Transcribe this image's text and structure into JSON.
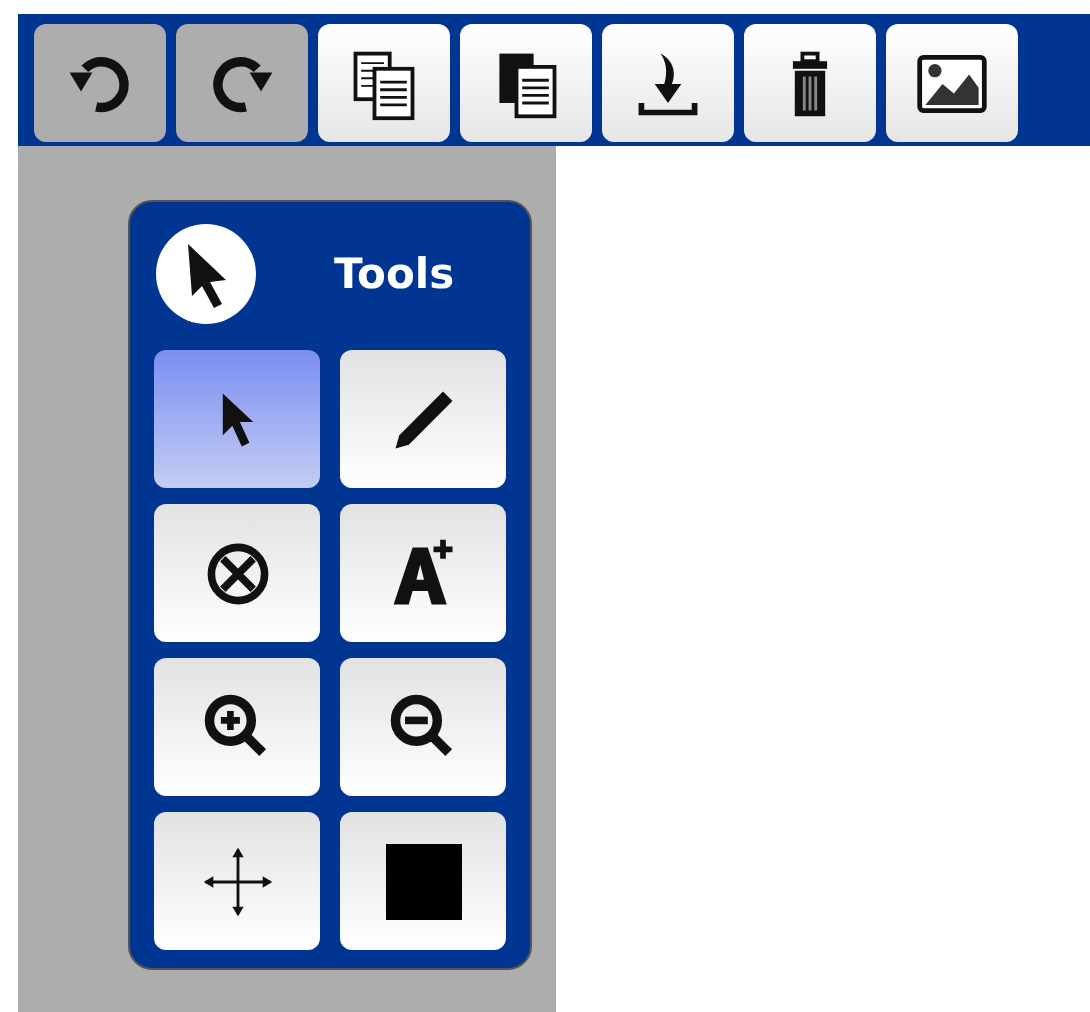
{
  "toolbar": [
    {
      "kind": "undo",
      "disabled": true
    },
    {
      "kind": "redo",
      "disabled": true
    },
    {
      "kind": "duplicate",
      "disabled": false
    },
    {
      "kind": "copy",
      "disabled": false
    },
    {
      "kind": "download",
      "disabled": false
    },
    {
      "kind": "delete",
      "disabled": false
    },
    {
      "kind": "image",
      "disabled": false
    }
  ],
  "tools_panel": {
    "title": "Tools",
    "tools": [
      {
        "kind": "select",
        "selected": true
      },
      {
        "kind": "pencil",
        "selected": false
      },
      {
        "kind": "erase",
        "selected": false
      },
      {
        "kind": "text",
        "selected": false
      },
      {
        "kind": "zoom_in",
        "selected": false
      },
      {
        "kind": "zoom_out",
        "selected": false
      },
      {
        "kind": "pan",
        "selected": false
      },
      {
        "kind": "color",
        "selected": false,
        "color": "#000000"
      }
    ]
  }
}
